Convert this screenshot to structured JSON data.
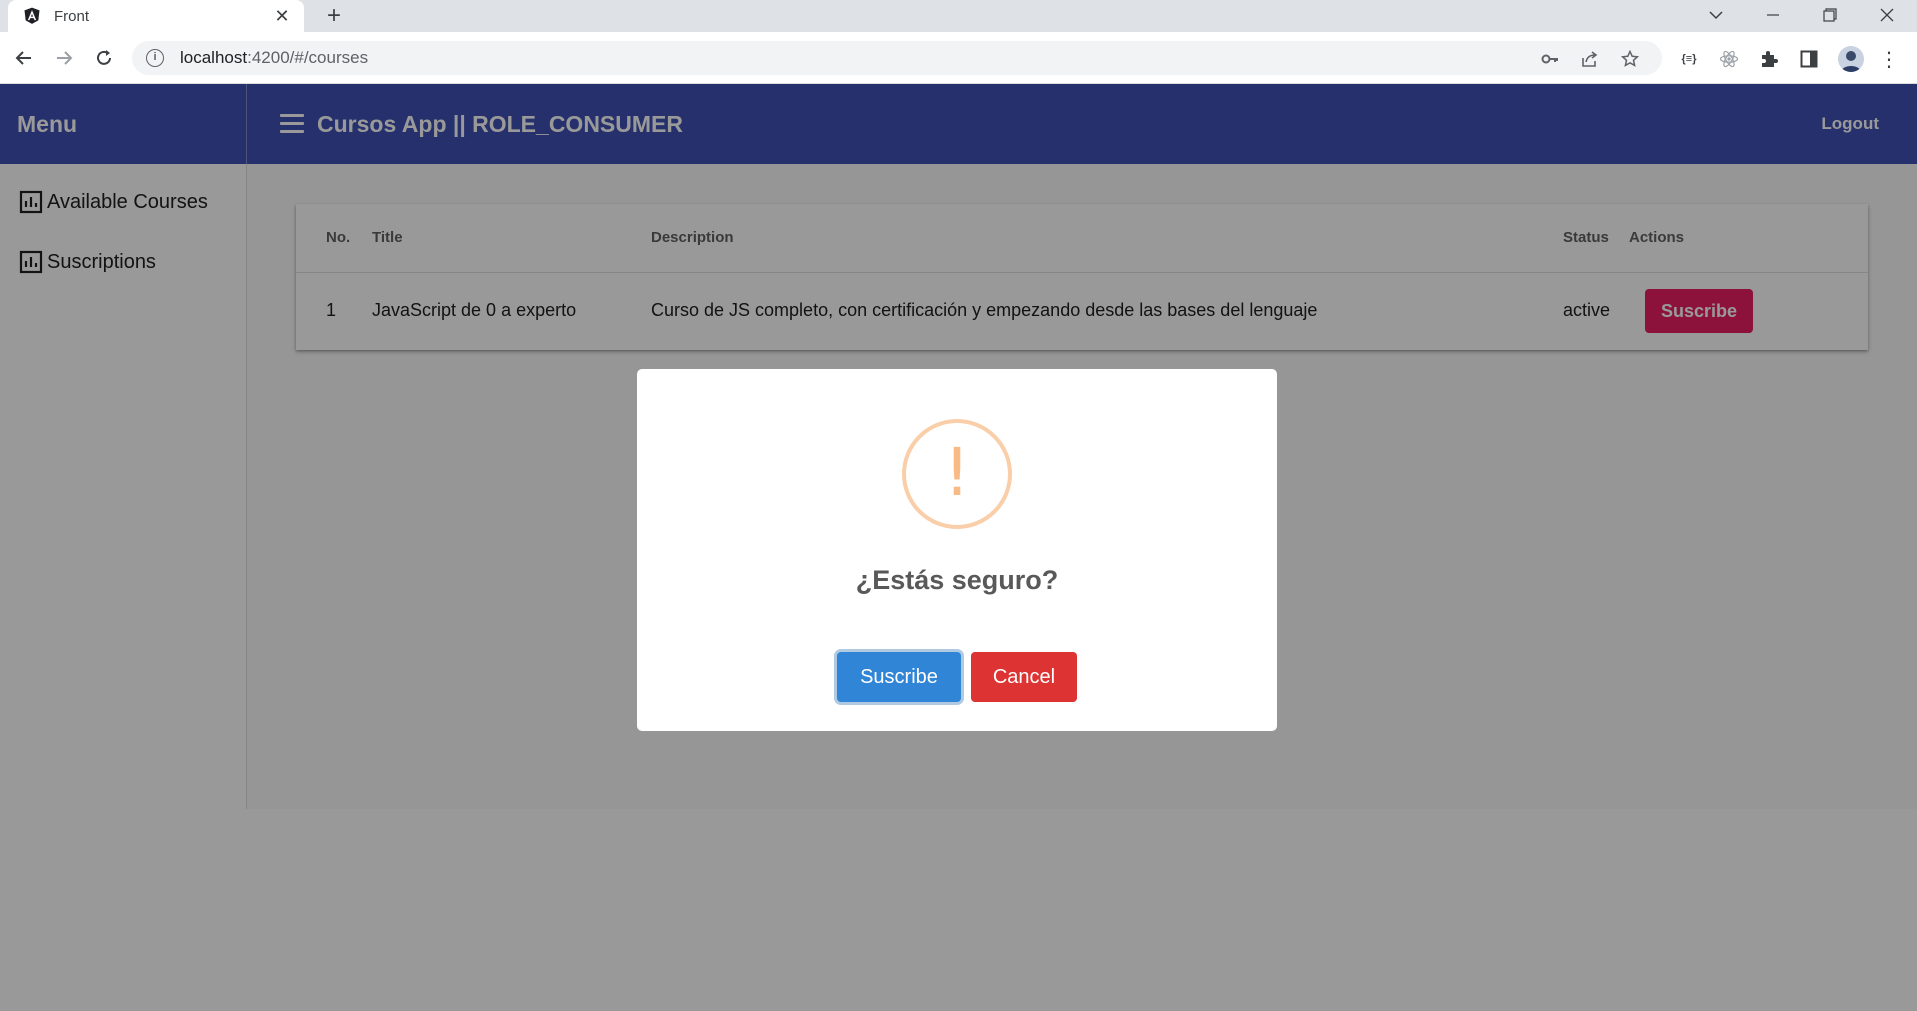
{
  "browser": {
    "tab_title": "Front",
    "url_host": "localhost",
    "url_path": ":4200/#/courses",
    "extension_json_label": "{≡}"
  },
  "header": {
    "menu_label": "Menu",
    "app_title": "Cursos App || ROLE_CONSUMER",
    "logout_label": "Logout"
  },
  "sidebar": {
    "items": [
      {
        "label": "Available Courses",
        "icon": "bar-chart-icon"
      },
      {
        "label": "Suscriptions",
        "icon": "bar-chart-icon"
      }
    ]
  },
  "table": {
    "columns": [
      "No.",
      "Title",
      "Description",
      "Status",
      "Actions"
    ],
    "rows": [
      {
        "no": "1",
        "title": "JavaScript de 0 a experto",
        "description": "Curso de JS completo, con certificación y empezando desde las bases del lenguaje",
        "status": "active",
        "action_label": "Suscribe"
      }
    ]
  },
  "dialog": {
    "icon": "!",
    "title": "¿Estás seguro?",
    "confirm_label": "Suscribe",
    "cancel_label": "Cancel"
  },
  "colors": {
    "header_bg": "#3f51b5",
    "row_button": "#e91e63",
    "confirm": "#3085d6",
    "cancel": "#dd3333",
    "warning": "#f8bb86"
  }
}
